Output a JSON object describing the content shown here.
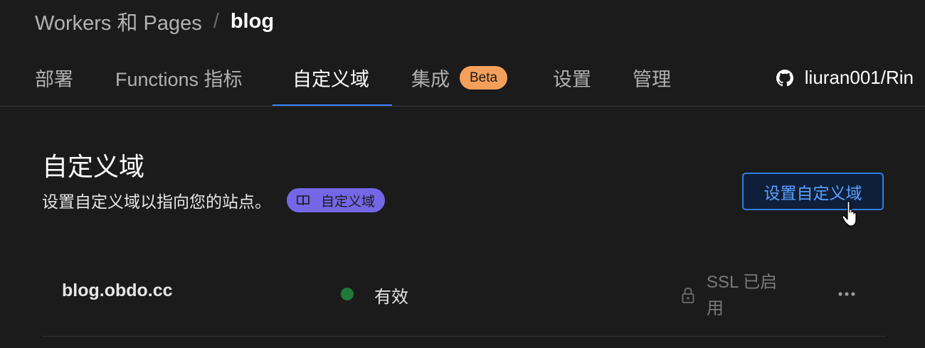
{
  "breadcrumb": {
    "parent": "Workers 和 Pages",
    "separator": "/",
    "current": "blog"
  },
  "tabs": [
    {
      "label": "部署"
    },
    {
      "label": "Functions 指标"
    },
    {
      "label": "自定义域",
      "active": true
    },
    {
      "label": "集成",
      "badge": "Beta"
    },
    {
      "label": "设置"
    },
    {
      "label": "管理"
    }
  ],
  "repo": {
    "icon": "github-icon",
    "label": "liuran001/Rin"
  },
  "section": {
    "title": "自定义域",
    "description": "设置自定义域以指向您的站点。",
    "doc_link": {
      "icon": "book-icon",
      "label": "自定义域"
    },
    "primary_button": "设置自定义域"
  },
  "domains": [
    {
      "name": "blog.obdo.cc",
      "status": "有效",
      "status_color": "#1f7a3a",
      "ssl": "SSL 已启用"
    }
  ],
  "colors": {
    "accent": "#3b82f6",
    "beta_badge": "#f5a05a",
    "doc_pill": "#7467e6"
  }
}
